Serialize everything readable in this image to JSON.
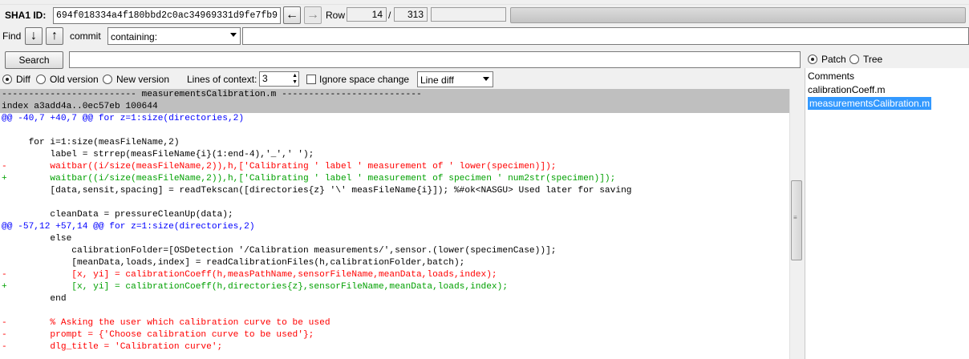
{
  "toolbar": {
    "sha1_label": "SHA1 ID:",
    "sha1_value": "694f018334a4f180bbd2c0ac34969331d9fe7fb9",
    "row_label": "Row",
    "row_current": "14",
    "row_sep": "/",
    "row_total": "313"
  },
  "find": {
    "label": "Find",
    "commit_label": "commit",
    "mode": "containing:"
  },
  "search": {
    "button": "Search",
    "patch_label": "Patch",
    "tree_label": "Tree"
  },
  "options": {
    "diff_label": "Diff",
    "old_label": "Old version",
    "new_label": "New version",
    "context_label": "Lines of context:",
    "context_value": "3",
    "ignore_label": "Ignore space change",
    "diff_mode": "Line diff"
  },
  "diff_lines": [
    {
      "type": "hdr",
      "text": "------------------------- measurementsCalibration.m --------------------------"
    },
    {
      "type": "hdr",
      "text": "index a3add4a..0ec57eb 100644"
    },
    {
      "type": "hunk",
      "text": "@@ -40,7 +40,7 @@ for z=1:size(directories,2)"
    },
    {
      "type": "ctx",
      "text": ""
    },
    {
      "type": "ctx",
      "text": "     for i=1:size(measFileName,2)"
    },
    {
      "type": "ctx",
      "text": "         label = strrep(measFileName{i}(1:end-4),'_',' ');"
    },
    {
      "type": "del",
      "text": "-        waitbar((i/size(measFileName,2)),h,['Calibrating ' label ' measurement of ' lower(specimen)]);"
    },
    {
      "type": "add",
      "text": "+        waitbar((i/size(measFileName,2)),h,['Calibrating ' label ' measurement of specimen ' num2str(specimen)]);"
    },
    {
      "type": "ctx",
      "text": "         [data,sensit,spacing] = readTekscan([directories{z} '\\' measFileName{i}]); %#ok<NASGU> Used later for saving"
    },
    {
      "type": "ctx",
      "text": ""
    },
    {
      "type": "ctx",
      "text": "         cleanData = pressureCleanUp(data);"
    },
    {
      "type": "hunk",
      "text": "@@ -57,12 +57,14 @@ for z=1:size(directories,2)"
    },
    {
      "type": "ctx",
      "text": "         else"
    },
    {
      "type": "ctx",
      "text": "             calibrationFolder=[OSDetection '/Calibration measurements/',sensor.(lower(specimenCase))];"
    },
    {
      "type": "ctx",
      "text": "             [meanData,loads,index] = readCalibrationFiles(h,calibrationFolder,batch);"
    },
    {
      "type": "del",
      "text": "-            [x, yi] = calibrationCoeff(h,measPathName,sensorFileName,meanData,loads,index);"
    },
    {
      "type": "add",
      "text": "+            [x, yi] = calibrationCoeff(h,directories{z},sensorFileName,meanData,loads,index);"
    },
    {
      "type": "ctx",
      "text": "         end"
    },
    {
      "type": "ctx",
      "text": ""
    },
    {
      "type": "del",
      "text": "-        % Asking the user which calibration curve to be used"
    },
    {
      "type": "del",
      "text": "-        prompt = {'Choose calibration curve to be used'};"
    },
    {
      "type": "del",
      "text": "-        dlg_title = 'Calibration curve';"
    }
  ],
  "files": {
    "items": [
      "Comments",
      "calibrationCoeff.m",
      "measurementsCalibration.m"
    ],
    "selected": "measurementsCalibration.m"
  }
}
